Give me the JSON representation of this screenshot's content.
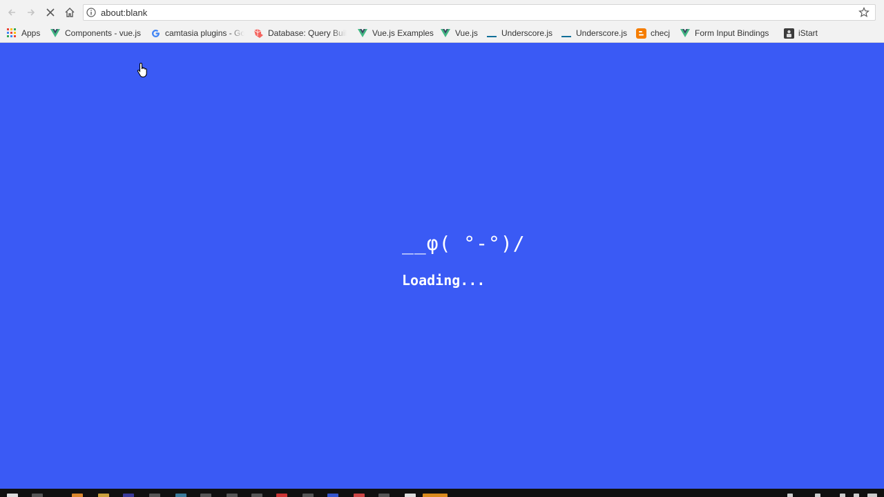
{
  "browser": {
    "url": "about:blank",
    "nav": {
      "back": "back-arrow-icon",
      "forward": "forward-arrow-icon",
      "stop": "stop-loading-icon",
      "home": "home-icon"
    }
  },
  "bookmarks": [
    {
      "label": "Apps",
      "icon": "apps-grid-icon"
    },
    {
      "label": "Components - vue.js",
      "icon": "vue-logo-icon"
    },
    {
      "label": "camtasia plugins - Go",
      "icon": "google-logo-icon"
    },
    {
      "label": "Database: Query Buil",
      "icon": "laravel-logo-icon"
    },
    {
      "label": "Vue.js Examples",
      "icon": "vue-logo-icon"
    },
    {
      "label": "Vue.js",
      "icon": "vue-logo-icon"
    },
    {
      "label": "Underscore.js",
      "icon": "underscore-icon"
    },
    {
      "label": "Underscore.js",
      "icon": "underscore-icon"
    },
    {
      "label": "checj",
      "icon": "blogger-icon"
    },
    {
      "label": "Form Input Bindings",
      "icon": "vue-logo-icon"
    },
    {
      "label": "iStart",
      "icon": "istart-icon"
    }
  ],
  "page": {
    "background": "#3a5af5",
    "kaomoji": "__φ( °-°)/",
    "loading_text": "Loading..."
  },
  "colors": {
    "vue_green": "#41b883",
    "vue_dark": "#35495e",
    "laravel_red": "#f4645f",
    "blogger_orange": "#f57d00",
    "apps_colors": [
      "#ea4335",
      "#fbbc05",
      "#34a853",
      "#4285f4"
    ]
  }
}
